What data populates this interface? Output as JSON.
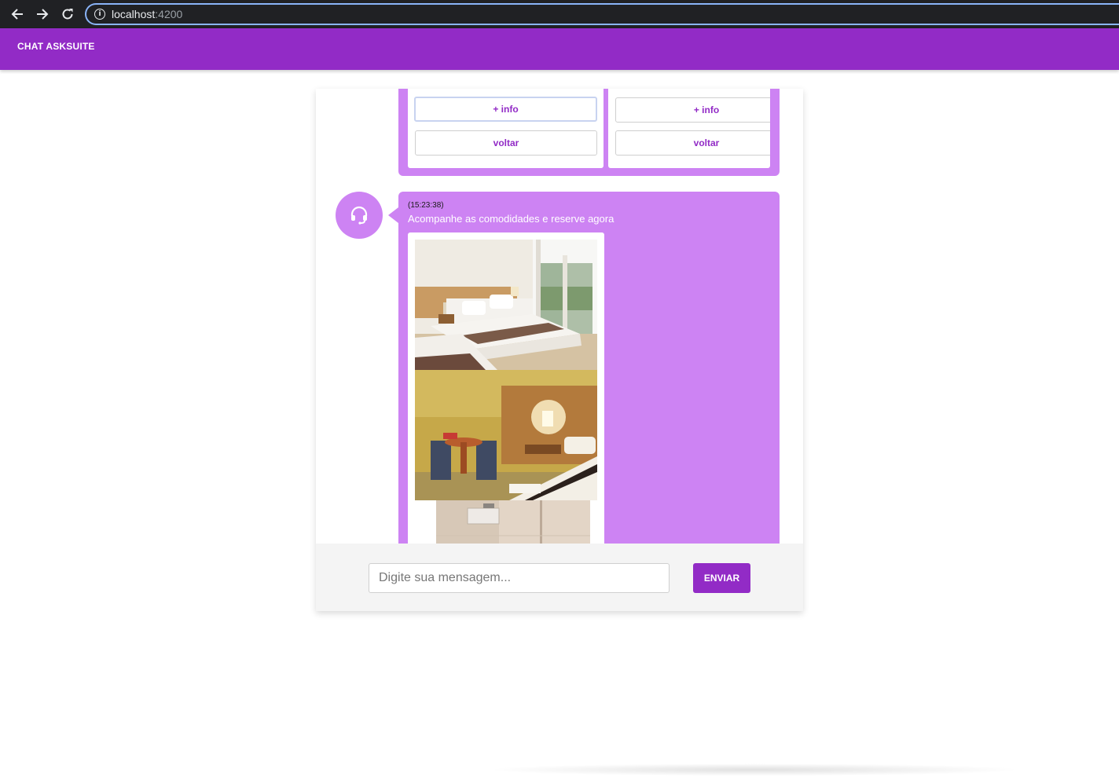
{
  "browser": {
    "url_host": "localhost",
    "url_port": ":4200"
  },
  "header": {
    "title": "CHAT ASKSUITE"
  },
  "messages": {
    "previous": {
      "options": [
        {
          "info_label": "+ info",
          "back_label": "voltar"
        },
        {
          "info_label": "+ info",
          "back_label": "voltar"
        }
      ]
    },
    "current": {
      "time": "(15:23:38)",
      "text": "Acompanhe as comodidades e reserve agora"
    }
  },
  "composer": {
    "placeholder": "Digite sua mensagem...",
    "send_label": "ENVIAR"
  },
  "colors": {
    "brand": "#922bc6",
    "bubble": "#cd83f3"
  }
}
